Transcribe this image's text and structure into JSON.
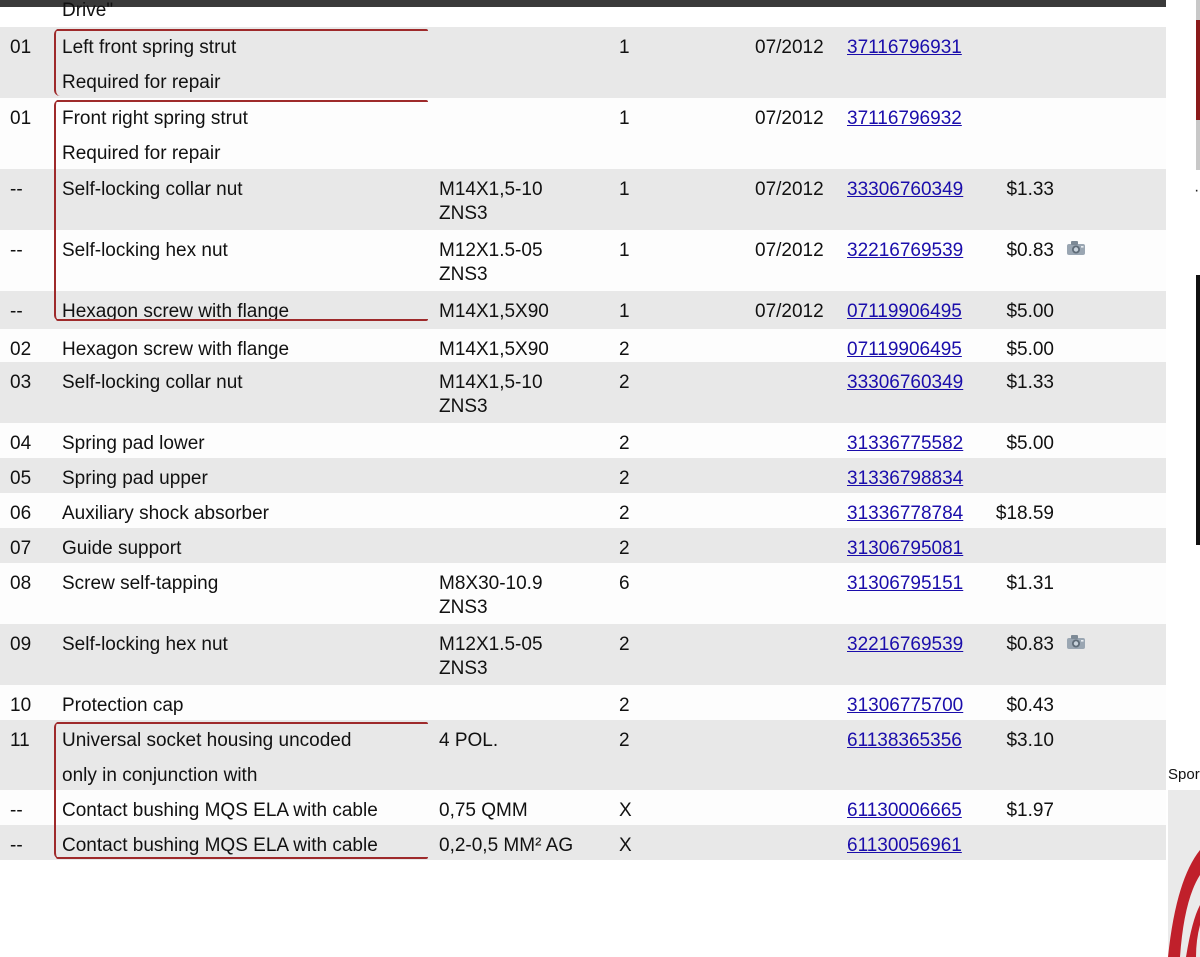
{
  "heading_fragment": "Drive\"",
  "rows": [
    {
      "ref": "01",
      "desc": "Left front spring strut",
      "suppl": "Required for repair",
      "spec": [],
      "qty": "1",
      "date": "07/2012",
      "part_number": "37116796931",
      "price": "",
      "camera": false
    },
    {
      "ref": "01",
      "desc": "Front right spring strut",
      "suppl": "Required for repair",
      "spec": [],
      "qty": "1",
      "date": "07/2012",
      "part_number": "37116796932",
      "price": "",
      "camera": false
    },
    {
      "ref": "--",
      "desc": "Self-locking collar nut",
      "suppl": "",
      "spec": [
        "M14X1,5-10",
        "ZNS3"
      ],
      "qty": "1",
      "date": "07/2012",
      "part_number": "33306760349",
      "price": "$1.33",
      "camera": false
    },
    {
      "ref": "--",
      "desc": "Self-locking hex nut",
      "suppl": "",
      "spec": [
        "M12X1.5-05",
        "ZNS3"
      ],
      "qty": "1",
      "date": "07/2012",
      "part_number": "32216769539",
      "price": "$0.83",
      "camera": true
    },
    {
      "ref": "--",
      "desc": "Hexagon screw with flange",
      "suppl": "",
      "spec": [
        "M14X1,5X90"
      ],
      "qty": "1",
      "date": "07/2012",
      "part_number": "07119906495",
      "price": "$5.00",
      "camera": false
    },
    {
      "ref": "02",
      "desc": "Hexagon screw with flange",
      "suppl": "",
      "spec": [
        "M14X1,5X90"
      ],
      "qty": "2",
      "date": "",
      "part_number": "07119906495",
      "price": "$5.00",
      "camera": false
    },
    {
      "ref": "03",
      "desc": "Self-locking collar nut",
      "suppl": "",
      "spec": [
        "M14X1,5-10",
        "ZNS3"
      ],
      "qty": "2",
      "date": "",
      "part_number": "33306760349",
      "price": "$1.33",
      "camera": false
    },
    {
      "ref": "04",
      "desc": "Spring pad lower",
      "suppl": "",
      "spec": [],
      "qty": "2",
      "date": "",
      "part_number": "31336775582",
      "price": "$5.00",
      "camera": false
    },
    {
      "ref": "05",
      "desc": "Spring pad upper",
      "suppl": "",
      "spec": [],
      "qty": "2",
      "date": "",
      "part_number": "31336798834",
      "price": "",
      "camera": false
    },
    {
      "ref": "06",
      "desc": "Auxiliary shock absorber",
      "suppl": "",
      "spec": [],
      "qty": "2",
      "date": "",
      "part_number": "31336778784",
      "price": "$18.59",
      "camera": false
    },
    {
      "ref": "07",
      "desc": "Guide support",
      "suppl": "",
      "spec": [],
      "qty": "2",
      "date": "",
      "part_number": "31306795081",
      "price": "",
      "camera": false
    },
    {
      "ref": "08",
      "desc": "Screw self-tapping",
      "suppl": "",
      "spec": [
        "M8X30-10.9",
        "ZNS3"
      ],
      "qty": "6",
      "date": "",
      "part_number": "31306795151",
      "price": "$1.31",
      "camera": false
    },
    {
      "ref": "09",
      "desc": "Self-locking hex nut",
      "suppl": "",
      "spec": [
        "M12X1.5-05",
        "ZNS3"
      ],
      "qty": "2",
      "date": "",
      "part_number": "32216769539",
      "price": "$0.83",
      "camera": true
    },
    {
      "ref": "10",
      "desc": "Protection cap",
      "suppl": "",
      "spec": [],
      "qty": "2",
      "date": "",
      "part_number": "31306775700",
      "price": "$0.43",
      "camera": false
    },
    {
      "ref": "11",
      "desc": "Universal socket housing uncoded",
      "suppl": "only in conjunction with",
      "spec": [
        "4 POL."
      ],
      "qty": "2",
      "date": "",
      "part_number": "61138365356",
      "price": "$3.10",
      "camera": false
    },
    {
      "ref": "--",
      "desc": "Contact bushing MQS ELA with cable",
      "suppl": "",
      "spec": [
        "0,75 QMM"
      ],
      "qty": "X",
      "date": "",
      "part_number": "61130006665",
      "price": "$1.97",
      "camera": false
    },
    {
      "ref": "--",
      "desc": "Contact bushing MQS ELA with cable",
      "suppl": "",
      "spec": [
        "0,2-0,5 MM² AG"
      ],
      "qty": "X",
      "date": "",
      "part_number": "61130056961",
      "price": "",
      "camera": false
    }
  ],
  "sidebar": {
    "sponsor_label": "Spor"
  },
  "colors": {
    "bracket": "#9e2a2b",
    "link": "#1a0dab",
    "row_shade": "#e8e8e8"
  }
}
